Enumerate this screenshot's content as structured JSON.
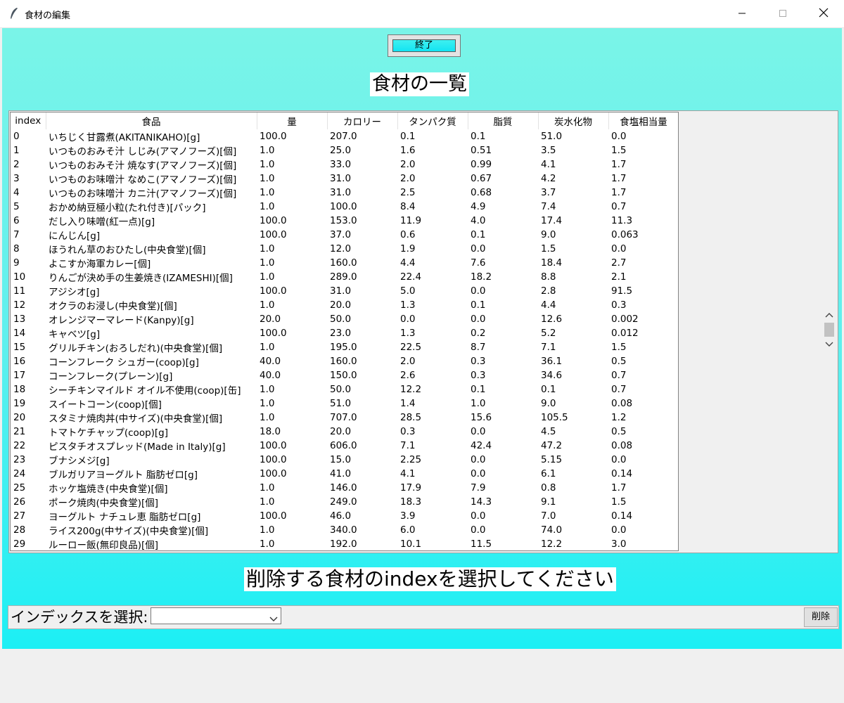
{
  "window": {
    "title": "食材の編集"
  },
  "toolbar": {
    "end_label": "終了"
  },
  "list_title": "食材の一覧",
  "table": {
    "columns": [
      "index",
      "食品",
      "量",
      "カロリー",
      "タンパク質",
      "脂質",
      "炭水化物",
      "食塩相当量"
    ],
    "rows": [
      [
        "0",
        "いちじく甘露煮(AKITANIKAHO)[g]",
        "100.0",
        "207.0",
        "0.1",
        "0.1",
        "51.0",
        "0.0"
      ],
      [
        "1",
        "いつものおみそ汁 しじみ(アマノフーズ)[個]",
        "1.0",
        "25.0",
        "1.6",
        "0.51",
        "3.5",
        "1.5"
      ],
      [
        "2",
        "いつものおみそ汁 焼なす(アマノフーズ)[個]",
        "1.0",
        "33.0",
        "2.0",
        "0.99",
        "4.1",
        "1.7"
      ],
      [
        "3",
        "いつものお味噌汁 なめこ(アマノフーズ)[個]",
        "1.0",
        "31.0",
        "2.0",
        "0.67",
        "4.2",
        "1.7"
      ],
      [
        "4",
        "いつものお味噌汁 カニ汁(アマノフーズ)[個]",
        "1.0",
        "31.0",
        "2.5",
        "0.68",
        "3.7",
        "1.7"
      ],
      [
        "5",
        "おかめ納豆極小粒(たれ付き)[パック]",
        "1.0",
        "100.0",
        "8.4",
        "4.9",
        "7.4",
        "0.7"
      ],
      [
        "6",
        "だし入り味噌(紅一点)[g]",
        "100.0",
        "153.0",
        "11.9",
        "4.0",
        "17.4",
        "11.3"
      ],
      [
        "7",
        "にんじん[g]",
        "100.0",
        "37.0",
        "0.6",
        "0.1",
        "9.0",
        "0.063"
      ],
      [
        "8",
        "ほうれん草のおひたし(中央食堂)[個]",
        "1.0",
        "12.0",
        "1.9",
        "0.0",
        "1.5",
        "0.0"
      ],
      [
        "9",
        "よこすか海軍カレー[個]",
        "1.0",
        "160.0",
        "4.4",
        "7.6",
        "18.4",
        "2.7"
      ],
      [
        "10",
        "りんごが決め手の生姜焼き(IZAMESHI)[個]",
        "1.0",
        "289.0",
        "22.4",
        "18.2",
        "8.8",
        "2.1"
      ],
      [
        "11",
        "アジシオ[g]",
        "100.0",
        "31.0",
        "5.0",
        "0.0",
        "2.8",
        "91.5"
      ],
      [
        "12",
        "オクラのお浸し(中央食堂)[個]",
        "1.0",
        "20.0",
        "1.3",
        "0.1",
        "4.4",
        "0.3"
      ],
      [
        "13",
        "オレンジマーマレード(Kanpy)[g]",
        "20.0",
        "50.0",
        "0.0",
        "0.0",
        "12.6",
        "0.002"
      ],
      [
        "14",
        "キャベツ[g]",
        "100.0",
        "23.0",
        "1.3",
        "0.2",
        "5.2",
        "0.012"
      ],
      [
        "15",
        "グリルチキン(おろしだれ)(中央食堂)[個]",
        "1.0",
        "195.0",
        "22.5",
        "8.7",
        "7.1",
        "1.5"
      ],
      [
        "16",
        "コーンフレーク シュガー(coop)[g]",
        "40.0",
        "160.0",
        "2.0",
        "0.3",
        "36.1",
        "0.5"
      ],
      [
        "17",
        "コーンフレーク(プレーン)[g]",
        "40.0",
        "150.0",
        "2.6",
        "0.3",
        "34.6",
        "0.7"
      ],
      [
        "18",
        "シーチキンマイルド オイル不使用(coop)[缶]",
        "1.0",
        "50.0",
        "12.2",
        "0.1",
        "0.1",
        "0.7"
      ],
      [
        "19",
        "スイートコーン(coop)[個]",
        "1.0",
        "51.0",
        "1.4",
        "1.0",
        "9.0",
        "0.08"
      ],
      [
        "20",
        "スタミナ焼肉丼(中サイズ)(中央食堂)[個]",
        "1.0",
        "707.0",
        "28.5",
        "15.6",
        "105.5",
        "1.2"
      ],
      [
        "21",
        "トマトケチャップ(coop)[g]",
        "18.0",
        "20.0",
        "0.3",
        "0.0",
        "4.5",
        "0.5"
      ],
      [
        "22",
        "ピスタチオスプレッド(Made in Italy)[g]",
        "100.0",
        "606.0",
        "7.1",
        "42.4",
        "47.2",
        "0.08"
      ],
      [
        "23",
        "ブナシメジ[g]",
        "100.0",
        "15.0",
        "2.25",
        "0.0",
        "5.15",
        "0.0"
      ],
      [
        "24",
        "ブルガリアヨーグルト 脂肪ゼロ[g]",
        "100.0",
        "41.0",
        "4.1",
        "0.0",
        "6.1",
        "0.14"
      ],
      [
        "25",
        "ホッケ塩焼き(中央食堂)[個]",
        "1.0",
        "146.0",
        "17.9",
        "7.9",
        "0.8",
        "1.7"
      ],
      [
        "26",
        "ポーク焼肉(中央食堂)[個]",
        "1.0",
        "249.0",
        "18.3",
        "14.3",
        "9.1",
        "1.5"
      ],
      [
        "27",
        "ヨーグルト ナチュレ恵 脂肪ゼロ[g]",
        "100.0",
        "46.0",
        "3.9",
        "0.0",
        "7.0",
        "0.14"
      ],
      [
        "28",
        "ライス200g(中サイズ)(中央食堂)[個]",
        "1.0",
        "340.0",
        "6.0",
        "0.0",
        "74.0",
        "0.0"
      ],
      [
        "29",
        "ルーロー飯(無印良品)[個]",
        "1.0",
        "192.0",
        "10.1",
        "11.5",
        "12.2",
        "3.0"
      ]
    ]
  },
  "delete_prompt": "削除する食材のindexを選択してください",
  "bottom": {
    "index_label": "インデックスを選択:",
    "select_value": "",
    "delete_label": "削除"
  },
  "icons": {
    "app": "feather-icon",
    "minimize": "minimize-icon",
    "maximize": "maximize-icon",
    "close": "close-icon",
    "dropdown": "chevron-down-icon"
  },
  "colors": {
    "background_top": "#7af4e8",
    "background_bottom": "#1ceff4",
    "button_cyan": "#13e4f2"
  }
}
